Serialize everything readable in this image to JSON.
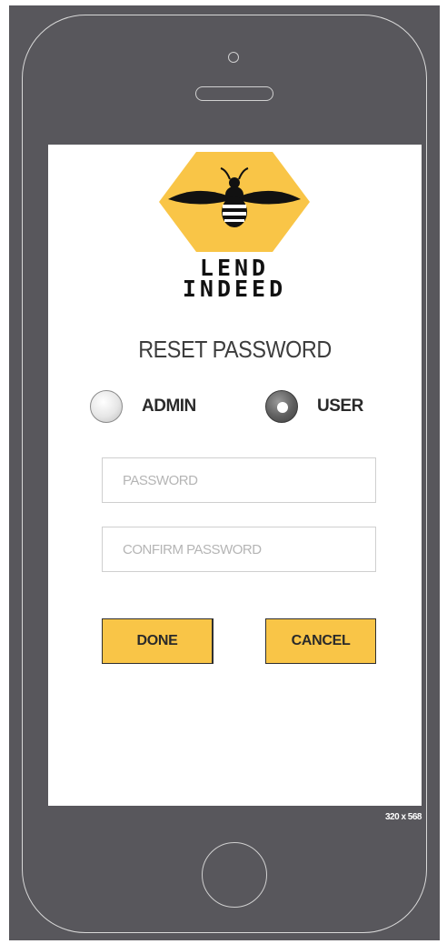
{
  "device": {
    "size_label": "320 x 568"
  },
  "logo": {
    "line1": "LEND",
    "line2": "INDEED",
    "hex_color": "#f9c547",
    "icon": "bee-icon"
  },
  "form": {
    "title": "RESET PASSWORD",
    "role_options": [
      {
        "label": "ADMIN",
        "selected": false
      },
      {
        "label": "USER",
        "selected": true
      }
    ],
    "password": {
      "value": "",
      "placeholder": "PASSWORD"
    },
    "confirm_password": {
      "value": "",
      "placeholder": "CONFIRM PASSWORD"
    },
    "done_label": "DONE",
    "cancel_label": "CANCEL"
  },
  "colors": {
    "accent": "#f9c547",
    "frame": "#58575c",
    "text": "#3d3d3d"
  }
}
